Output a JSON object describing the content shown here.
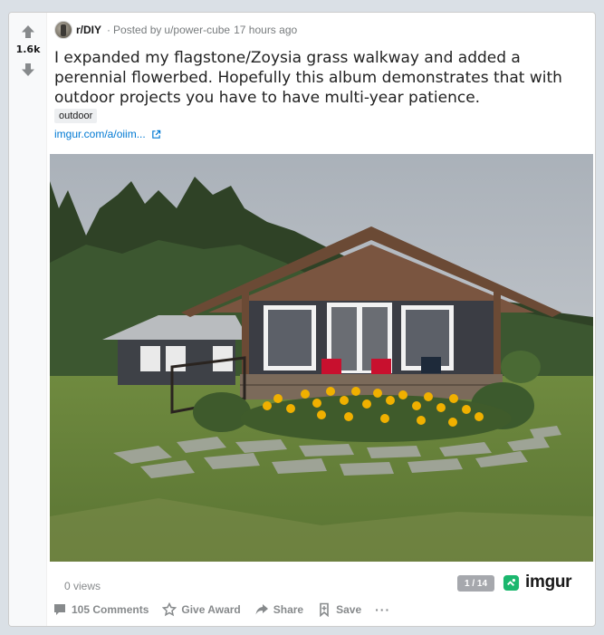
{
  "post": {
    "score": "1.6k",
    "subreddit": "r/DIY",
    "posted_by_prefix": "Posted by",
    "author": "u/power-cube",
    "time": "17 hours ago",
    "title": "I expanded my flagstone/Zoysia grass walkway and added a perennial flowerbed. Hopefully this album demonstrates that with outdoor projects you have to have multi-year patience.",
    "flair": "outdoor",
    "link_text": "imgur.com/a/oiim...",
    "views": "0 views",
    "album_position": "1 / 14",
    "embed_provider": "imgur"
  },
  "actions": {
    "comments": "105 Comments",
    "give_award": "Give Award",
    "share": "Share",
    "save": "Save",
    "more": "···"
  },
  "icons": {
    "upvote": "arrow-up-icon",
    "downvote": "arrow-down-icon",
    "external_link": "external-link-icon",
    "comments": "comment-icon",
    "award": "award-icon",
    "share": "share-icon",
    "save": "bookmark-icon",
    "imgur_logo": "imgur-logo-icon"
  },
  "colors": {
    "accent_link": "#0079d3",
    "meta_text": "#787c7e",
    "page_background": "#dae0e6",
    "imgur_green": "#1bb76e"
  }
}
